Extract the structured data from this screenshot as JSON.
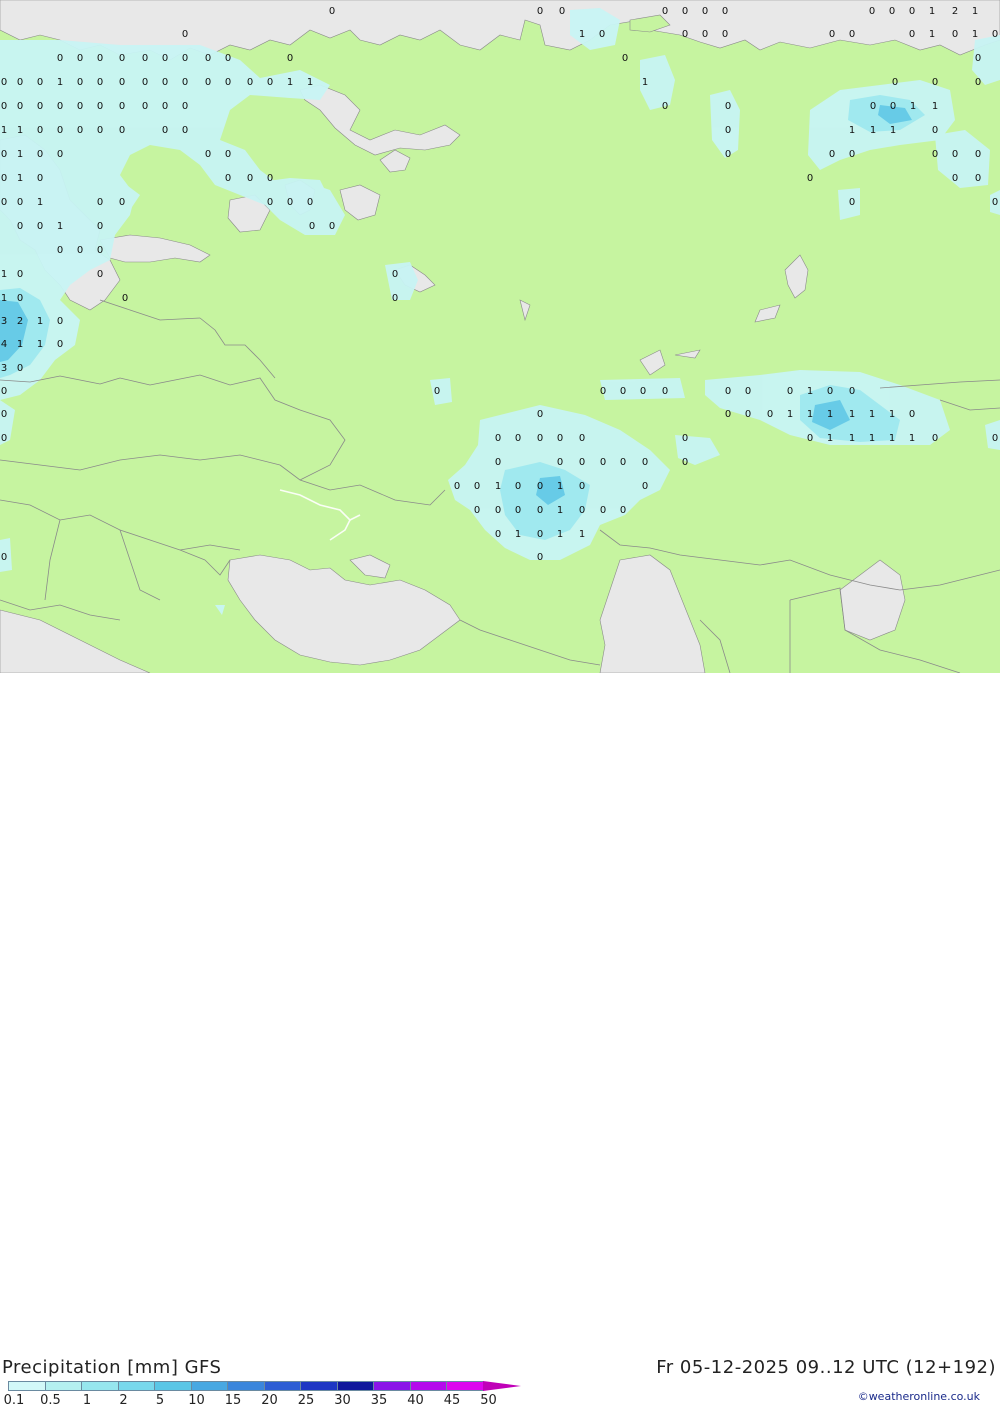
{
  "map": {
    "land_color": "#c6f4a0",
    "sea_color": "#e8e8e8",
    "precip_light": "#c8f4f4",
    "precip_medium": "#9ee8ee",
    "precip_strong": "#60c8e6",
    "border_color": "#8a8a8a",
    "grid_values": [
      [
        "0",
        185,
        33
      ],
      [
        "0",
        332,
        10
      ],
      [
        "0",
        540,
        10
      ],
      [
        "0",
        562,
        10
      ],
      [
        "0",
        665,
        10
      ],
      [
        "0",
        685,
        10
      ],
      [
        "0",
        705,
        10
      ],
      [
        "0",
        725,
        10
      ],
      [
        "0",
        872,
        10
      ],
      [
        "0",
        892,
        10
      ],
      [
        "0",
        912,
        10
      ],
      [
        "1",
        932,
        10
      ],
      [
        "2",
        955,
        10
      ],
      [
        "1",
        975,
        10
      ],
      [
        "1",
        582,
        33
      ],
      [
        "0",
        602,
        33
      ],
      [
        "0",
        685,
        33
      ],
      [
        "0",
        705,
        33
      ],
      [
        "0",
        725,
        33
      ],
      [
        "0",
        832,
        33
      ],
      [
        "0",
        852,
        33
      ],
      [
        "0",
        912,
        33
      ],
      [
        "1",
        932,
        33
      ],
      [
        "0",
        955,
        33
      ],
      [
        "1",
        975,
        33
      ],
      [
        "0",
        995,
        33
      ],
      [
        "0",
        60,
        57
      ],
      [
        "0",
        80,
        57
      ],
      [
        "0",
        100,
        57
      ],
      [
        "0",
        122,
        57
      ],
      [
        "0",
        145,
        57
      ],
      [
        "0",
        165,
        57
      ],
      [
        "0",
        185,
        57
      ],
      [
        "0",
        208,
        57
      ],
      [
        "0",
        228,
        57
      ],
      [
        "0",
        290,
        57
      ],
      [
        "0",
        625,
        57
      ],
      [
        "0",
        978,
        57
      ],
      [
        "0",
        0,
        81
      ],
      [
        "0",
        20,
        81
      ],
      [
        "0",
        40,
        81
      ],
      [
        "1",
        60,
        81
      ],
      [
        "0",
        80,
        81
      ],
      [
        "0",
        100,
        81
      ],
      [
        "0",
        122,
        81
      ],
      [
        "0",
        145,
        81
      ],
      [
        "0",
        165,
        81
      ],
      [
        "0",
        185,
        81
      ],
      [
        "0",
        208,
        81
      ],
      [
        "0",
        228,
        81
      ],
      [
        "0",
        250,
        81
      ],
      [
        "0",
        270,
        81
      ],
      [
        "1",
        290,
        81
      ],
      [
        "1",
        310,
        81
      ],
      [
        "1",
        645,
        81
      ],
      [
        "0",
        895,
        81
      ],
      [
        "0",
        935,
        81
      ],
      [
        "0",
        978,
        81
      ],
      [
        "0",
        0,
        105
      ],
      [
        "0",
        20,
        105
      ],
      [
        "0",
        40,
        105
      ],
      [
        "0",
        60,
        105
      ],
      [
        "0",
        80,
        105
      ],
      [
        "0",
        100,
        105
      ],
      [
        "0",
        122,
        105
      ],
      [
        "0",
        145,
        105
      ],
      [
        "0",
        165,
        105
      ],
      [
        "0",
        185,
        105
      ],
      [
        "0",
        665,
        105
      ],
      [
        "0",
        728,
        105
      ],
      [
        "0",
        873,
        105
      ],
      [
        "0",
        893,
        105
      ],
      [
        "1",
        913,
        105
      ],
      [
        "1",
        935,
        105
      ],
      [
        "1",
        0,
        129
      ],
      [
        "1",
        20,
        129
      ],
      [
        "0",
        40,
        129
      ],
      [
        "0",
        60,
        129
      ],
      [
        "0",
        80,
        129
      ],
      [
        "0",
        100,
        129
      ],
      [
        "0",
        122,
        129
      ],
      [
        "0",
        165,
        129
      ],
      [
        "0",
        185,
        129
      ],
      [
        "0",
        728,
        129
      ],
      [
        "1",
        852,
        129
      ],
      [
        "1",
        873,
        129
      ],
      [
        "1",
        893,
        129
      ],
      [
        "0",
        935,
        129
      ],
      [
        "0",
        0,
        153
      ],
      [
        "1",
        20,
        153
      ],
      [
        "0",
        40,
        153
      ],
      [
        "0",
        60,
        153
      ],
      [
        "0",
        208,
        153
      ],
      [
        "0",
        228,
        153
      ],
      [
        "0",
        728,
        153
      ],
      [
        "0",
        832,
        153
      ],
      [
        "0",
        852,
        153
      ],
      [
        "0",
        935,
        153
      ],
      [
        "0",
        955,
        153
      ],
      [
        "0",
        978,
        153
      ],
      [
        "0",
        0,
        177
      ],
      [
        "1",
        20,
        177
      ],
      [
        "0",
        40,
        177
      ],
      [
        "0",
        228,
        177
      ],
      [
        "0",
        250,
        177
      ],
      [
        "0",
        270,
        177
      ],
      [
        "0",
        810,
        177
      ],
      [
        "0",
        955,
        177
      ],
      [
        "0",
        978,
        177
      ],
      [
        "0",
        0,
        201
      ],
      [
        "0",
        20,
        201
      ],
      [
        "1",
        40,
        201
      ],
      [
        "0",
        100,
        201
      ],
      [
        "0",
        122,
        201
      ],
      [
        "0",
        270,
        201
      ],
      [
        "0",
        290,
        201
      ],
      [
        "0",
        310,
        201
      ],
      [
        "0",
        852,
        201
      ],
      [
        "0",
        995,
        201
      ],
      [
        "0",
        20,
        225
      ],
      [
        "0",
        40,
        225
      ],
      [
        "1",
        60,
        225
      ],
      [
        "0",
        100,
        225
      ],
      [
        "0",
        312,
        225
      ],
      [
        "0",
        332,
        225
      ],
      [
        "0",
        60,
        249
      ],
      [
        "0",
        80,
        249
      ],
      [
        "0",
        100,
        249
      ],
      [
        "1",
        0,
        273
      ],
      [
        "0",
        20,
        273
      ],
      [
        "0",
        100,
        273
      ],
      [
        "0",
        395,
        273
      ],
      [
        "1",
        0,
        297
      ],
      [
        "0",
        20,
        297
      ],
      [
        "0",
        125,
        297
      ],
      [
        "0",
        395,
        297
      ],
      [
        "3",
        0,
        320
      ],
      [
        "2",
        20,
        320
      ],
      [
        "1",
        40,
        320
      ],
      [
        "0",
        60,
        320
      ],
      [
        "4",
        0,
        343
      ],
      [
        "1",
        20,
        343
      ],
      [
        "1",
        40,
        343
      ],
      [
        "0",
        60,
        343
      ],
      [
        "3",
        0,
        367
      ],
      [
        "0",
        20,
        367
      ],
      [
        "0",
        0,
        390
      ],
      [
        "0",
        437,
        390
      ],
      [
        "0",
        603,
        390
      ],
      [
        "0",
        623,
        390
      ],
      [
        "0",
        643,
        390
      ],
      [
        "0",
        665,
        390
      ],
      [
        "0",
        728,
        390
      ],
      [
        "0",
        748,
        390
      ],
      [
        "0",
        790,
        390
      ],
      [
        "1",
        810,
        390
      ],
      [
        "0",
        830,
        390
      ],
      [
        "0",
        852,
        390
      ],
      [
        "0",
        0,
        413
      ],
      [
        "0",
        540,
        413
      ],
      [
        "0",
        728,
        413
      ],
      [
        "0",
        748,
        413
      ],
      [
        "0",
        770,
        413
      ],
      [
        "1",
        790,
        413
      ],
      [
        "1",
        810,
        413
      ],
      [
        "1",
        830,
        413
      ],
      [
        "1",
        852,
        413
      ],
      [
        "1",
        872,
        413
      ],
      [
        "1",
        892,
        413
      ],
      [
        "0",
        912,
        413
      ],
      [
        "0",
        0,
        437
      ],
      [
        "0",
        498,
        437
      ],
      [
        "0",
        518,
        437
      ],
      [
        "0",
        540,
        437
      ],
      [
        "0",
        560,
        437
      ],
      [
        "0",
        582,
        437
      ],
      [
        "0",
        685,
        437
      ],
      [
        "0",
        810,
        437
      ],
      [
        "1",
        830,
        437
      ],
      [
        "1",
        852,
        437
      ],
      [
        "1",
        872,
        437
      ],
      [
        "1",
        892,
        437
      ],
      [
        "1",
        912,
        437
      ],
      [
        "0",
        935,
        437
      ],
      [
        "0",
        995,
        437
      ],
      [
        "0",
        498,
        461
      ],
      [
        "0",
        560,
        461
      ],
      [
        "0",
        582,
        461
      ],
      [
        "0",
        603,
        461
      ],
      [
        "0",
        623,
        461
      ],
      [
        "0",
        645,
        461
      ],
      [
        "0",
        685,
        461
      ],
      [
        "0",
        457,
        485
      ],
      [
        "0",
        477,
        485
      ],
      [
        "1",
        498,
        485
      ],
      [
        "0",
        518,
        485
      ],
      [
        "0",
        540,
        485
      ],
      [
        "1",
        560,
        485
      ],
      [
        "0",
        582,
        485
      ],
      [
        "0",
        645,
        485
      ],
      [
        "0",
        477,
        509
      ],
      [
        "0",
        498,
        509
      ],
      [
        "0",
        518,
        509
      ],
      [
        "0",
        540,
        509
      ],
      [
        "1",
        560,
        509
      ],
      [
        "0",
        582,
        509
      ],
      [
        "0",
        603,
        509
      ],
      [
        "0",
        623,
        509
      ],
      [
        "0",
        498,
        533
      ],
      [
        "1",
        518,
        533
      ],
      [
        "0",
        540,
        533
      ],
      [
        "1",
        560,
        533
      ],
      [
        "1",
        582,
        533
      ],
      [
        "0",
        540,
        556
      ],
      [
        "0",
        0,
        556
      ]
    ]
  },
  "footer": {
    "title": "Precipitation [mm] GFS",
    "datetime": "Fr 05-12-2025 09..12 UTC (12+192)",
    "credit": "©weatheronline.co.uk"
  },
  "legend": {
    "labels": [
      "0.1",
      "0.5",
      "1",
      "2",
      "5",
      "10",
      "15",
      "20",
      "25",
      "30",
      "35",
      "40",
      "45",
      "50"
    ],
    "colors": [
      "#d2f8f8",
      "#b4f0f0",
      "#96e6ee",
      "#78d8ec",
      "#5ac6e6",
      "#48a8e2",
      "#3a86dc",
      "#2c5ed4",
      "#1e38c4",
      "#10189c",
      "#8a14e8",
      "#b40aec",
      "#dc06ee",
      "#e800d8",
      "#c000b8"
    ]
  }
}
